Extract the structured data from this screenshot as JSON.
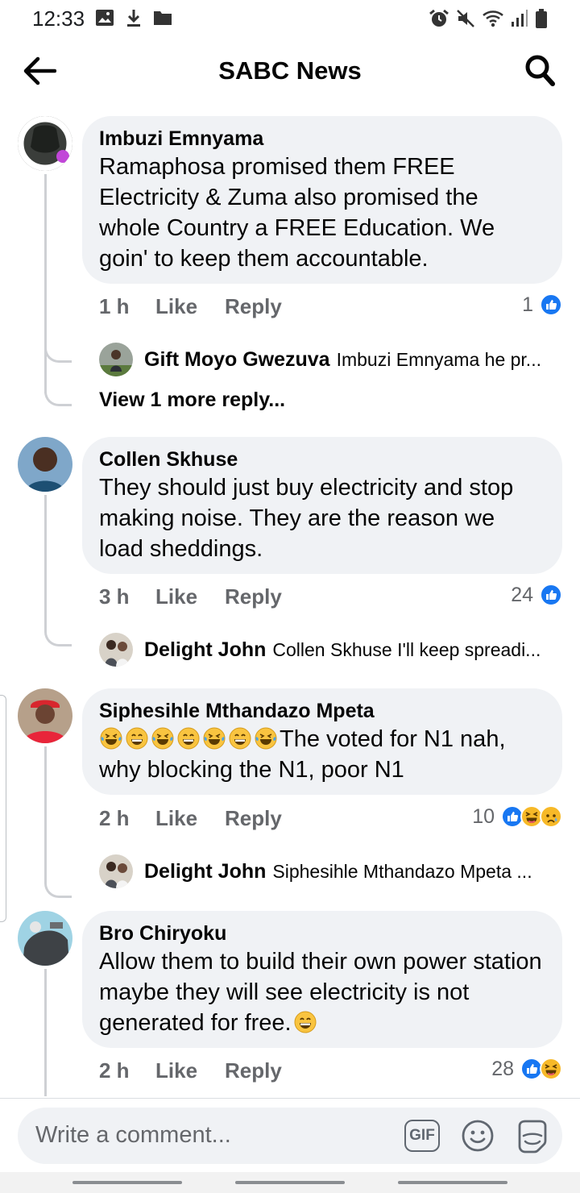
{
  "status_bar": {
    "time": "12:33",
    "left_icons": [
      "image-icon",
      "download-icon",
      "folder-icon"
    ],
    "right_icons": [
      "alarm-icon",
      "mute-icon",
      "wifi-icon",
      "signal-icon",
      "battery-icon"
    ]
  },
  "header": {
    "title": "SABC News",
    "back_icon": "back-arrow-icon",
    "search_icon": "search-icon"
  },
  "comments": [
    {
      "author": "Imbuzi Emnyama",
      "text": "Ramaphosa promised them FREE Electricity & Zuma also promised the whole Country a FREE Education. We goin' to keep them accountable.",
      "time": "1 h",
      "like_label": "Like",
      "reply_label": "Reply",
      "reaction_count": "1",
      "reactions": [
        "like"
      ],
      "reply_preview": {
        "author": "Gift Moyo Gwezuva",
        "text": "Imbuzi Emnyama he pr..."
      },
      "more_replies": "View 1 more reply..."
    },
    {
      "author": "Collen Skhuse",
      "text": "They should just buy electricity and stop making noise. They are the reason we load sheddings.",
      "time": "3 h",
      "like_label": "Like",
      "reply_label": "Reply",
      "reaction_count": "24",
      "reactions": [
        "like"
      ],
      "reply_preview": {
        "author": "Delight John",
        "text": "Collen Skhuse  I'll keep spreadi..."
      }
    },
    {
      "author": "Siphesihle Mthandazo Mpeta",
      "emoji_prefix": [
        "laughing-tears",
        "grin",
        "laughing-tears",
        "grin",
        "laughing-tears",
        "grin",
        "laughing-tears"
      ],
      "text": "The voted for N1 nah, why blocking the N1, poor N1",
      "time": "2 h",
      "like_label": "Like",
      "reply_label": "Reply",
      "reaction_count": "10",
      "reactions": [
        "like",
        "haha",
        "sad"
      ],
      "reply_preview": {
        "author": "Delight John",
        "text": "Siphesihle Mthandazo Mpeta  ..."
      }
    },
    {
      "author": "Bro Chiryoku",
      "text": "Allow them to build their own power station maybe they will see electricity is not generated for free.",
      "emoji_suffix": [
        "grin"
      ],
      "time": "2 h",
      "like_label": "Like",
      "reply_label": "Reply",
      "reaction_count": "28",
      "reactions": [
        "like",
        "haha"
      ]
    }
  ],
  "composer": {
    "placeholder": "Write a comment...",
    "gif_label": "GIF",
    "emoji_icon": "smiley-icon",
    "sticker_icon": "sticker-icon"
  },
  "colors": {
    "bubble": "#f0f2f5",
    "secondary_text": "#65676b",
    "like_blue": "#1877f2",
    "reaction_yellow": "#f7b928"
  }
}
